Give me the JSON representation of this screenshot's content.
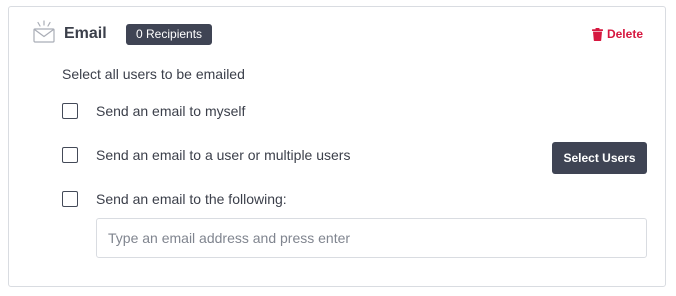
{
  "header": {
    "icon": "mail-icon",
    "title": "Email",
    "recipients_badge": "0 Recipients",
    "delete_label": "Delete",
    "delete_icon": "trash-icon"
  },
  "instruction": "Select all users to be emailed",
  "options": [
    {
      "label": "Send an email to myself",
      "checked": false
    },
    {
      "label": "Send an email to a user or multiple users",
      "checked": false
    },
    {
      "label": "Send an email to the following:",
      "checked": false
    }
  ],
  "select_users_label": "Select Users",
  "email_input": {
    "value": "",
    "placeholder": "Type an email address and press enter"
  },
  "colors": {
    "accent_dark": "#3f4454",
    "danger": "#d6173f",
    "border": "#d9dce1",
    "text": "#3b3f4a"
  }
}
